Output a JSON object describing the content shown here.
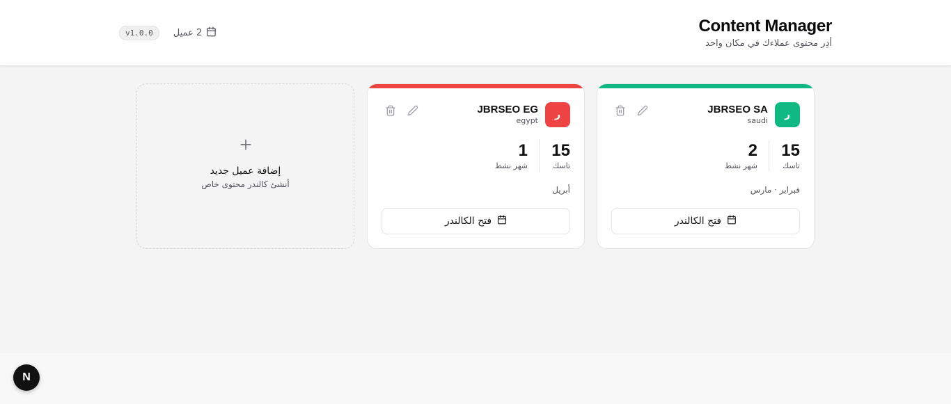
{
  "header": {
    "title": "Content Manager",
    "subtitle": "أدِر محتوى عملاءك في مكان واحد",
    "client_count": "2 عميل",
    "version": "v1.0.0"
  },
  "clients": [
    {
      "name": "JBRSEO SA",
      "slug": "saudi",
      "avatar": "ر",
      "color": "#10b981",
      "tasks": "15",
      "tasks_label": "تاسك",
      "months": "2",
      "months_label": "شهر نشط",
      "month_names": "فبراير · مارس",
      "open_label": "فتح الكالندر"
    },
    {
      "name": "JBRSEO EG",
      "slug": "egypt",
      "avatar": "ر",
      "color": "#ef4444",
      "tasks": "15",
      "tasks_label": "تاسك",
      "months": "1",
      "months_label": "شهر نشط",
      "month_names": "أبريل",
      "open_label": "فتح الكالندر"
    }
  ],
  "add_client": {
    "title": "إضافة عميل جديد",
    "subtitle": "أنشئ كالندر محتوى خاص"
  },
  "dev_badge": "N"
}
